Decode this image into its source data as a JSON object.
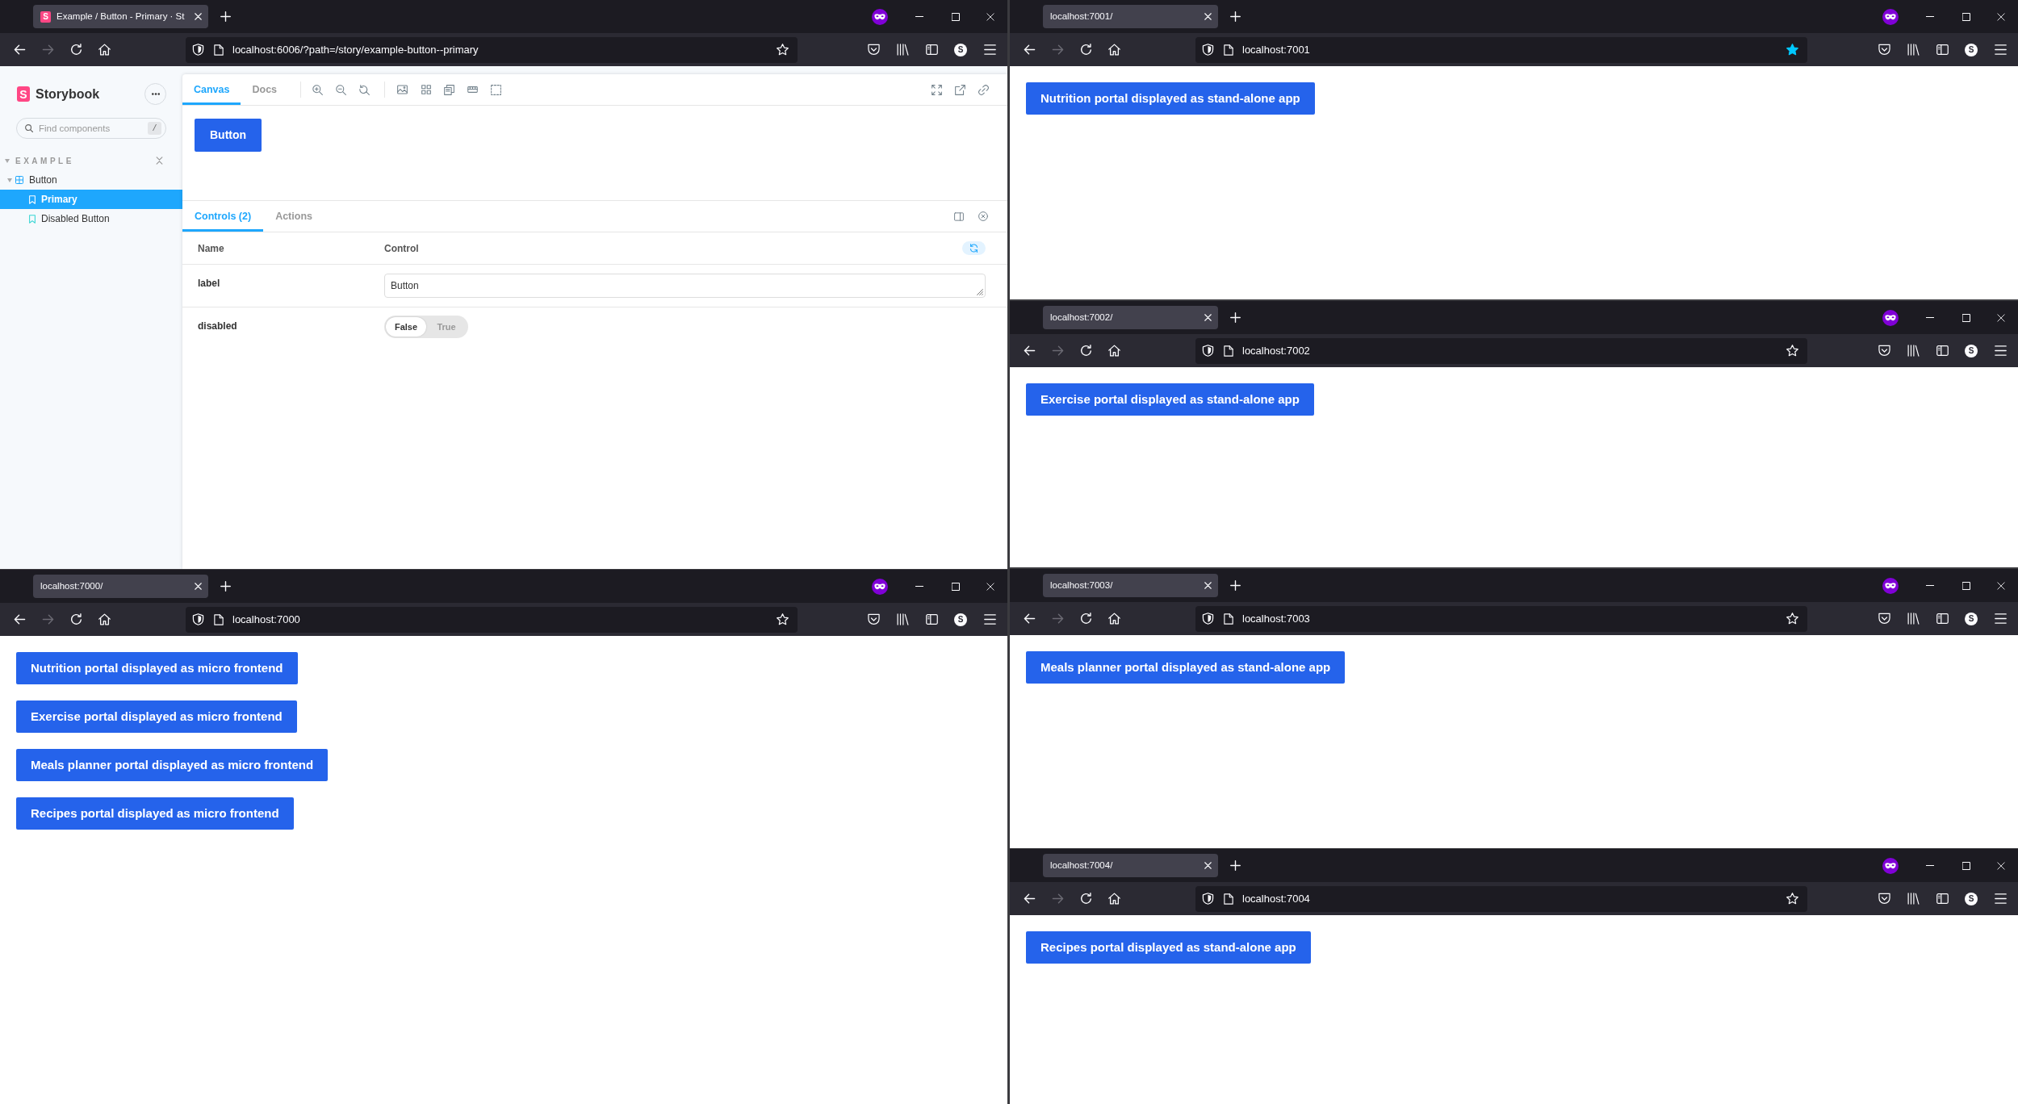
{
  "windows": [
    {
      "tab": {
        "title": "Example / Button - Primary · St",
        "favicon": "S",
        "selected": true
      },
      "can_go_forward": false,
      "url": "localhost:6006/?path=/story/example-button--primary",
      "bookmarked": false,
      "account_initial": "S",
      "content": {
        "kind": "storybook",
        "sidebar": {
          "logo": "S",
          "brand": "Storybook",
          "search": {
            "placeholder": "Find components",
            "shortcut": "/"
          },
          "tree": [
            {
              "label": "EXAMPLE",
              "kind": "group",
              "expanded": true,
              "children": [
                {
                  "label": "Button",
                  "kind": "component",
                  "expanded": true,
                  "selected": false,
                  "children": [
                    {
                      "label": "Primary",
                      "kind": "story",
                      "selected": true
                    },
                    {
                      "label": "Disabled Button",
                      "kind": "story",
                      "selected": false
                    }
                  ]
                }
              ]
            }
          ]
        },
        "toolbar_tabs": [
          {
            "label": "Canvas",
            "selected": true
          },
          {
            "label": "Docs",
            "selected": false
          }
        ],
        "preview_button": "Button",
        "addons": {
          "tabs": [
            {
              "label": "Controls (2)",
              "selected": true
            },
            {
              "label": "Actions",
              "selected": false
            }
          ],
          "columns": [
            "Name",
            "Control"
          ],
          "rows": [
            {
              "name": "label",
              "kind": "text",
              "value": "Button"
            },
            {
              "name": "disabled",
              "kind": "boolean",
              "options": [
                {
                  "label": "False",
                  "selected": true
                },
                {
                  "label": "True",
                  "selected": false
                }
              ]
            }
          ]
        }
      }
    },
    {
      "tab": {
        "title": "localhost:7001/",
        "selected": true
      },
      "can_go_forward": false,
      "url": "localhost:7001",
      "bookmarked": true,
      "account_initial": "S",
      "content": {
        "kind": "page",
        "buttons": [
          "Nutrition portal displayed as stand-alone app"
        ]
      }
    },
    {
      "tab": {
        "title": "localhost:7002/",
        "selected": true
      },
      "can_go_forward": false,
      "url": "localhost:7002",
      "bookmarked": false,
      "account_initial": "S",
      "content": {
        "kind": "page",
        "buttons": [
          "Exercise portal displayed as stand-alone app"
        ]
      }
    },
    {
      "tab": {
        "title": "localhost:7000/",
        "selected": true
      },
      "can_go_forward": false,
      "url": "localhost:7000",
      "bookmarked": false,
      "account_initial": "S",
      "content": {
        "kind": "page",
        "buttons": [
          "Nutrition portal displayed as micro frontend",
          "Exercise portal displayed as micro frontend",
          "Meals planner portal displayed as micro frontend",
          "Recipes portal displayed as micro frontend"
        ]
      }
    },
    {
      "tab": {
        "title": "localhost:7003/",
        "selected": true
      },
      "can_go_forward": false,
      "url": "localhost:7003",
      "bookmarked": false,
      "account_initial": "S",
      "content": {
        "kind": "page",
        "buttons": [
          "Meals planner portal displayed as stand-alone app"
        ]
      }
    },
    {
      "tab": {
        "title": "localhost:7004/",
        "selected": true
      },
      "can_go_forward": false,
      "url": "localhost:7004",
      "bookmarked": false,
      "account_initial": "S",
      "content": {
        "kind": "page",
        "buttons": [
          "Recipes portal displayed as stand-alone app"
        ]
      }
    }
  ]
}
